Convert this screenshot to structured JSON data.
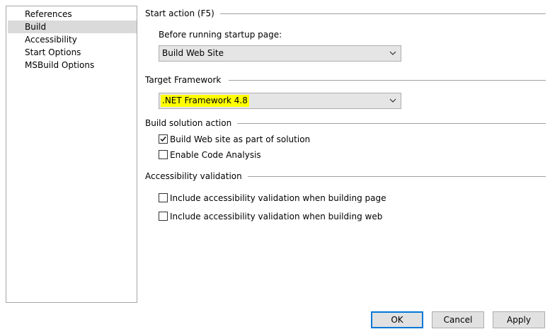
{
  "nav": {
    "items": [
      {
        "label": "References",
        "selected": false
      },
      {
        "label": "Build",
        "selected": true
      },
      {
        "label": "Accessibility",
        "selected": false
      },
      {
        "label": "Start Options",
        "selected": false
      },
      {
        "label": "MSBuild Options",
        "selected": false
      }
    ]
  },
  "start_action": {
    "header": "Start action (F5)",
    "before_label": "Before running startup page:",
    "before_value": "Build Web Site"
  },
  "target_framework": {
    "header": "Target Framework",
    "value": ".NET Framework 4.8",
    "highlight_color": "#ffff00"
  },
  "build_solution": {
    "header": "Build solution action",
    "options": [
      {
        "label": "Build Web site as part of solution",
        "checked": true
      },
      {
        "label": "Enable Code Analysis",
        "checked": false
      }
    ]
  },
  "accessibility": {
    "header": "Accessibility validation",
    "options": [
      {
        "label": "Include accessibility validation when building page",
        "checked": false
      },
      {
        "label": "Include accessibility validation when building web",
        "checked": false
      }
    ]
  },
  "buttons": {
    "ok": "OK",
    "cancel": "Cancel",
    "apply": "Apply"
  },
  "colors": {
    "accent": "#0078d7",
    "selection": "#dadada"
  }
}
